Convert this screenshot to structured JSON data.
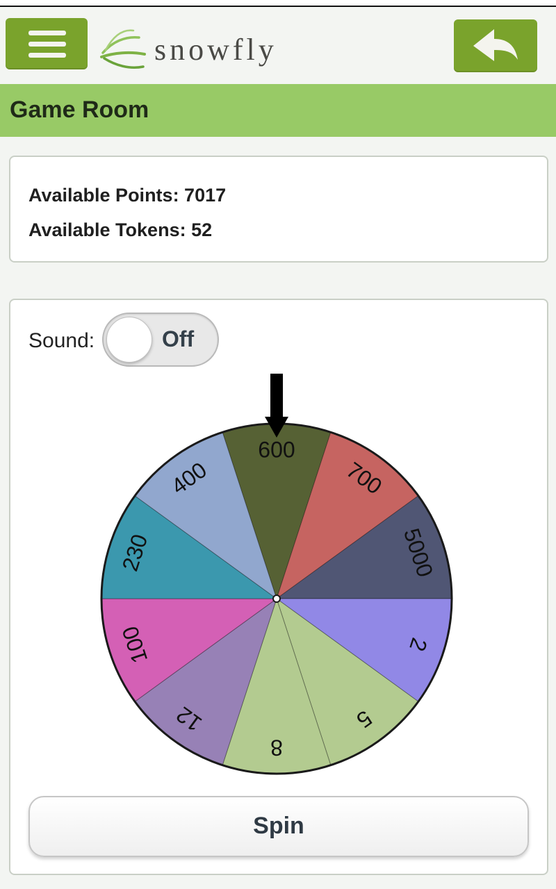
{
  "header": {
    "logo_text": "snowfly"
  },
  "page": {
    "title": "Game Room"
  },
  "stats": {
    "points_line": "Available Points: 7017",
    "tokens_line": "Available Tokens: 52"
  },
  "sound": {
    "label": "Sound:",
    "state": "Off"
  },
  "wheel": {
    "segments": [
      {
        "label": "600",
        "color": "#566134"
      },
      {
        "label": "700",
        "color": "#c66461"
      },
      {
        "label": "5000",
        "color": "#505674"
      },
      {
        "label": "2",
        "color": "#9188e6"
      },
      {
        "label": "5",
        "color": "#b3cb90"
      },
      {
        "label": "8",
        "color": "#b3cb90"
      },
      {
        "label": "12",
        "color": "#9781b6"
      },
      {
        "label": "100",
        "color": "#d460b5"
      },
      {
        "label": "230",
        "color": "#3b98ae"
      },
      {
        "label": "400",
        "color": "#91a7ce"
      }
    ]
  },
  "spin_button": {
    "label": "Spin"
  },
  "colors": {
    "accent": "#7aa32c",
    "title_bar": "#98ca66"
  }
}
